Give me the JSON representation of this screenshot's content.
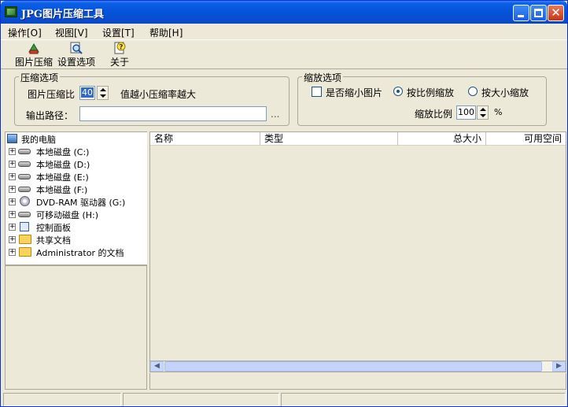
{
  "window": {
    "title": "JPG图片压缩工具"
  },
  "menubar": {
    "items": [
      "操作[O]",
      "视图[V]",
      "设置[T]",
      "帮助[H]"
    ]
  },
  "toolbar": {
    "compress_label": "图片压缩",
    "settings_label": "设置选项",
    "about_label": "关于"
  },
  "compress_options": {
    "group_label": "压缩选项",
    "ratio_label": "图片压缩比",
    "ratio_value": "40",
    "ratio_hint": "值越小压缩率越大",
    "output_label": "输出路径：",
    "output_value": "",
    "browse_label": "..."
  },
  "scale_options": {
    "group_label": "缩放选项",
    "shrink_label": "是否缩小图片",
    "shrink_checked": false,
    "by_ratio_label": "按比例缩放",
    "by_size_label": "按大小缩放",
    "selected": "by_ratio",
    "scale_label": "缩放比例",
    "scale_value": "100",
    "scale_unit": "%"
  },
  "tree": {
    "root": "我的电脑",
    "items": [
      {
        "label": "本地磁盘 (C:)",
        "icon": "hard-drive-icon"
      },
      {
        "label": "本地磁盘 (D:)",
        "icon": "hard-drive-icon"
      },
      {
        "label": "本地磁盘 (E:)",
        "icon": "hard-drive-icon"
      },
      {
        "label": "本地磁盘 (F:)",
        "icon": "hard-drive-icon"
      },
      {
        "label": "DVD-RAM 驱动器 (G:)",
        "icon": "dvd-drive-icon"
      },
      {
        "label": "可移动磁盘 (H:)",
        "icon": "removable-drive-icon"
      },
      {
        "label": "控制面板",
        "icon": "control-panel-icon"
      },
      {
        "label": "共享文档",
        "icon": "folder-icon"
      },
      {
        "label": "Administrator 的文档",
        "icon": "folder-icon"
      }
    ]
  },
  "list": {
    "columns": [
      "名称",
      "类型",
      "总大小",
      "可用空间"
    ]
  },
  "statusbar": {
    "panels": [
      "",
      "",
      ""
    ]
  }
}
